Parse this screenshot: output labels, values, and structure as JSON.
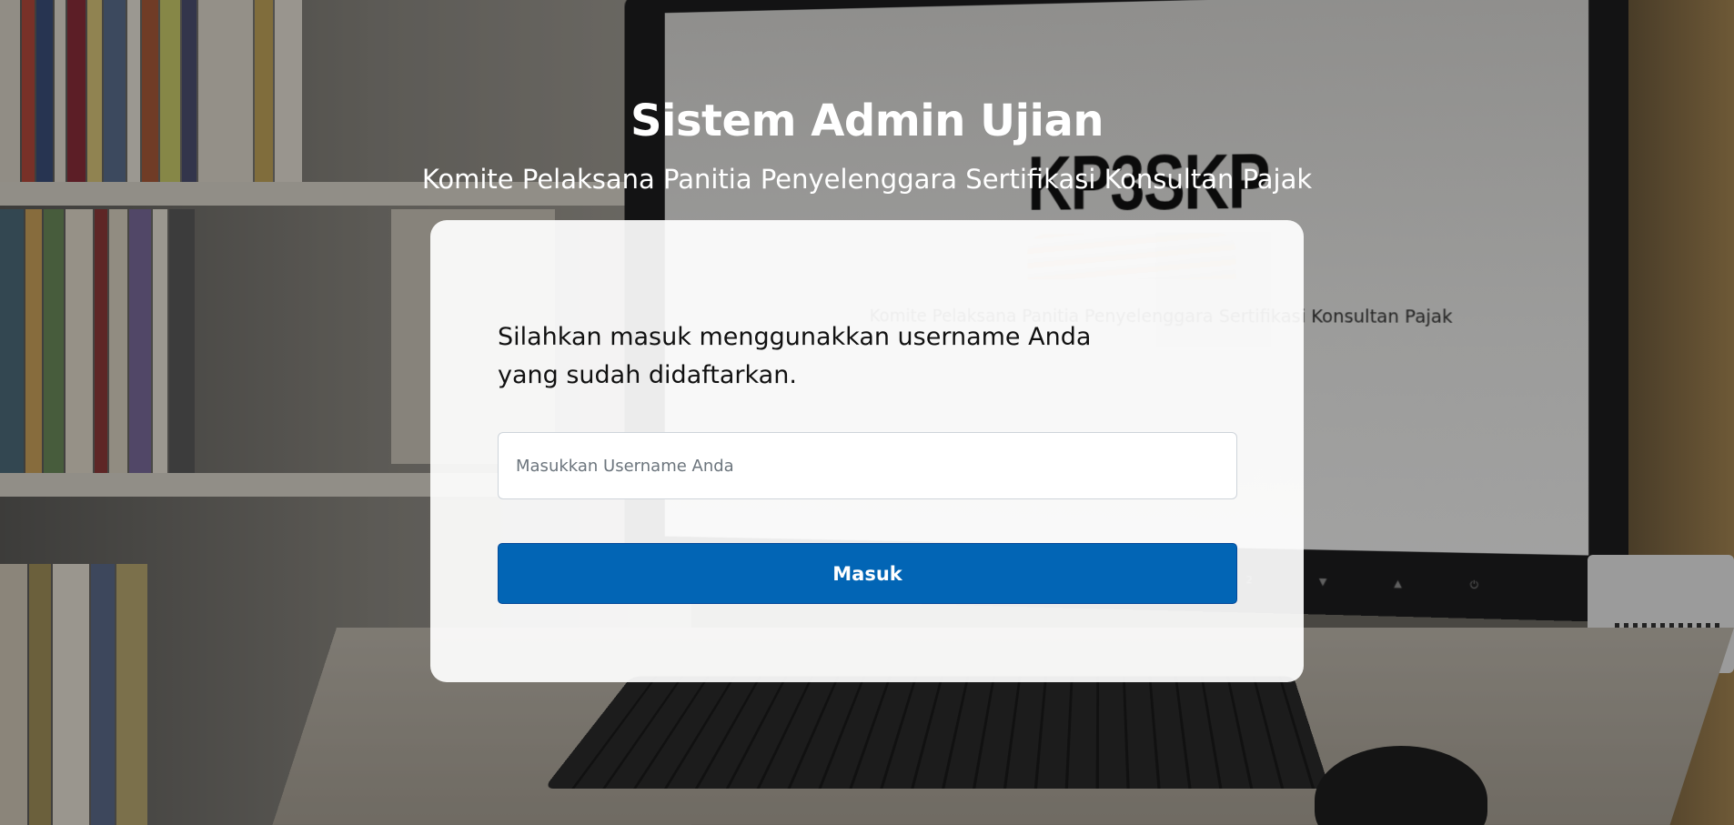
{
  "header": {
    "title": "Sistem Admin Ujian",
    "subtitle": "Komite Pelaksana Panitia Penyelenggara Sertifikasi Konsultan Pajak"
  },
  "login": {
    "instructions": "Silahkan masuk menggunakkan username Anda yang sudah didaftarkan.",
    "username_value": "",
    "username_placeholder": "Masukkan Username Anda",
    "submit_label": "Masuk"
  },
  "background_screen": {
    "logo_text": "KP3SKP",
    "caption": "Komite Pelaksana Panitia Penyelenggara Sertifikasi Konsultan Pajak",
    "button_glyphs": "1 2 ▼ ▲ ⏻"
  },
  "colors": {
    "primary_button": "#0265b5",
    "card_background": "#ffffff",
    "title_text": "#ffffff",
    "instruction_text": "#111111"
  }
}
